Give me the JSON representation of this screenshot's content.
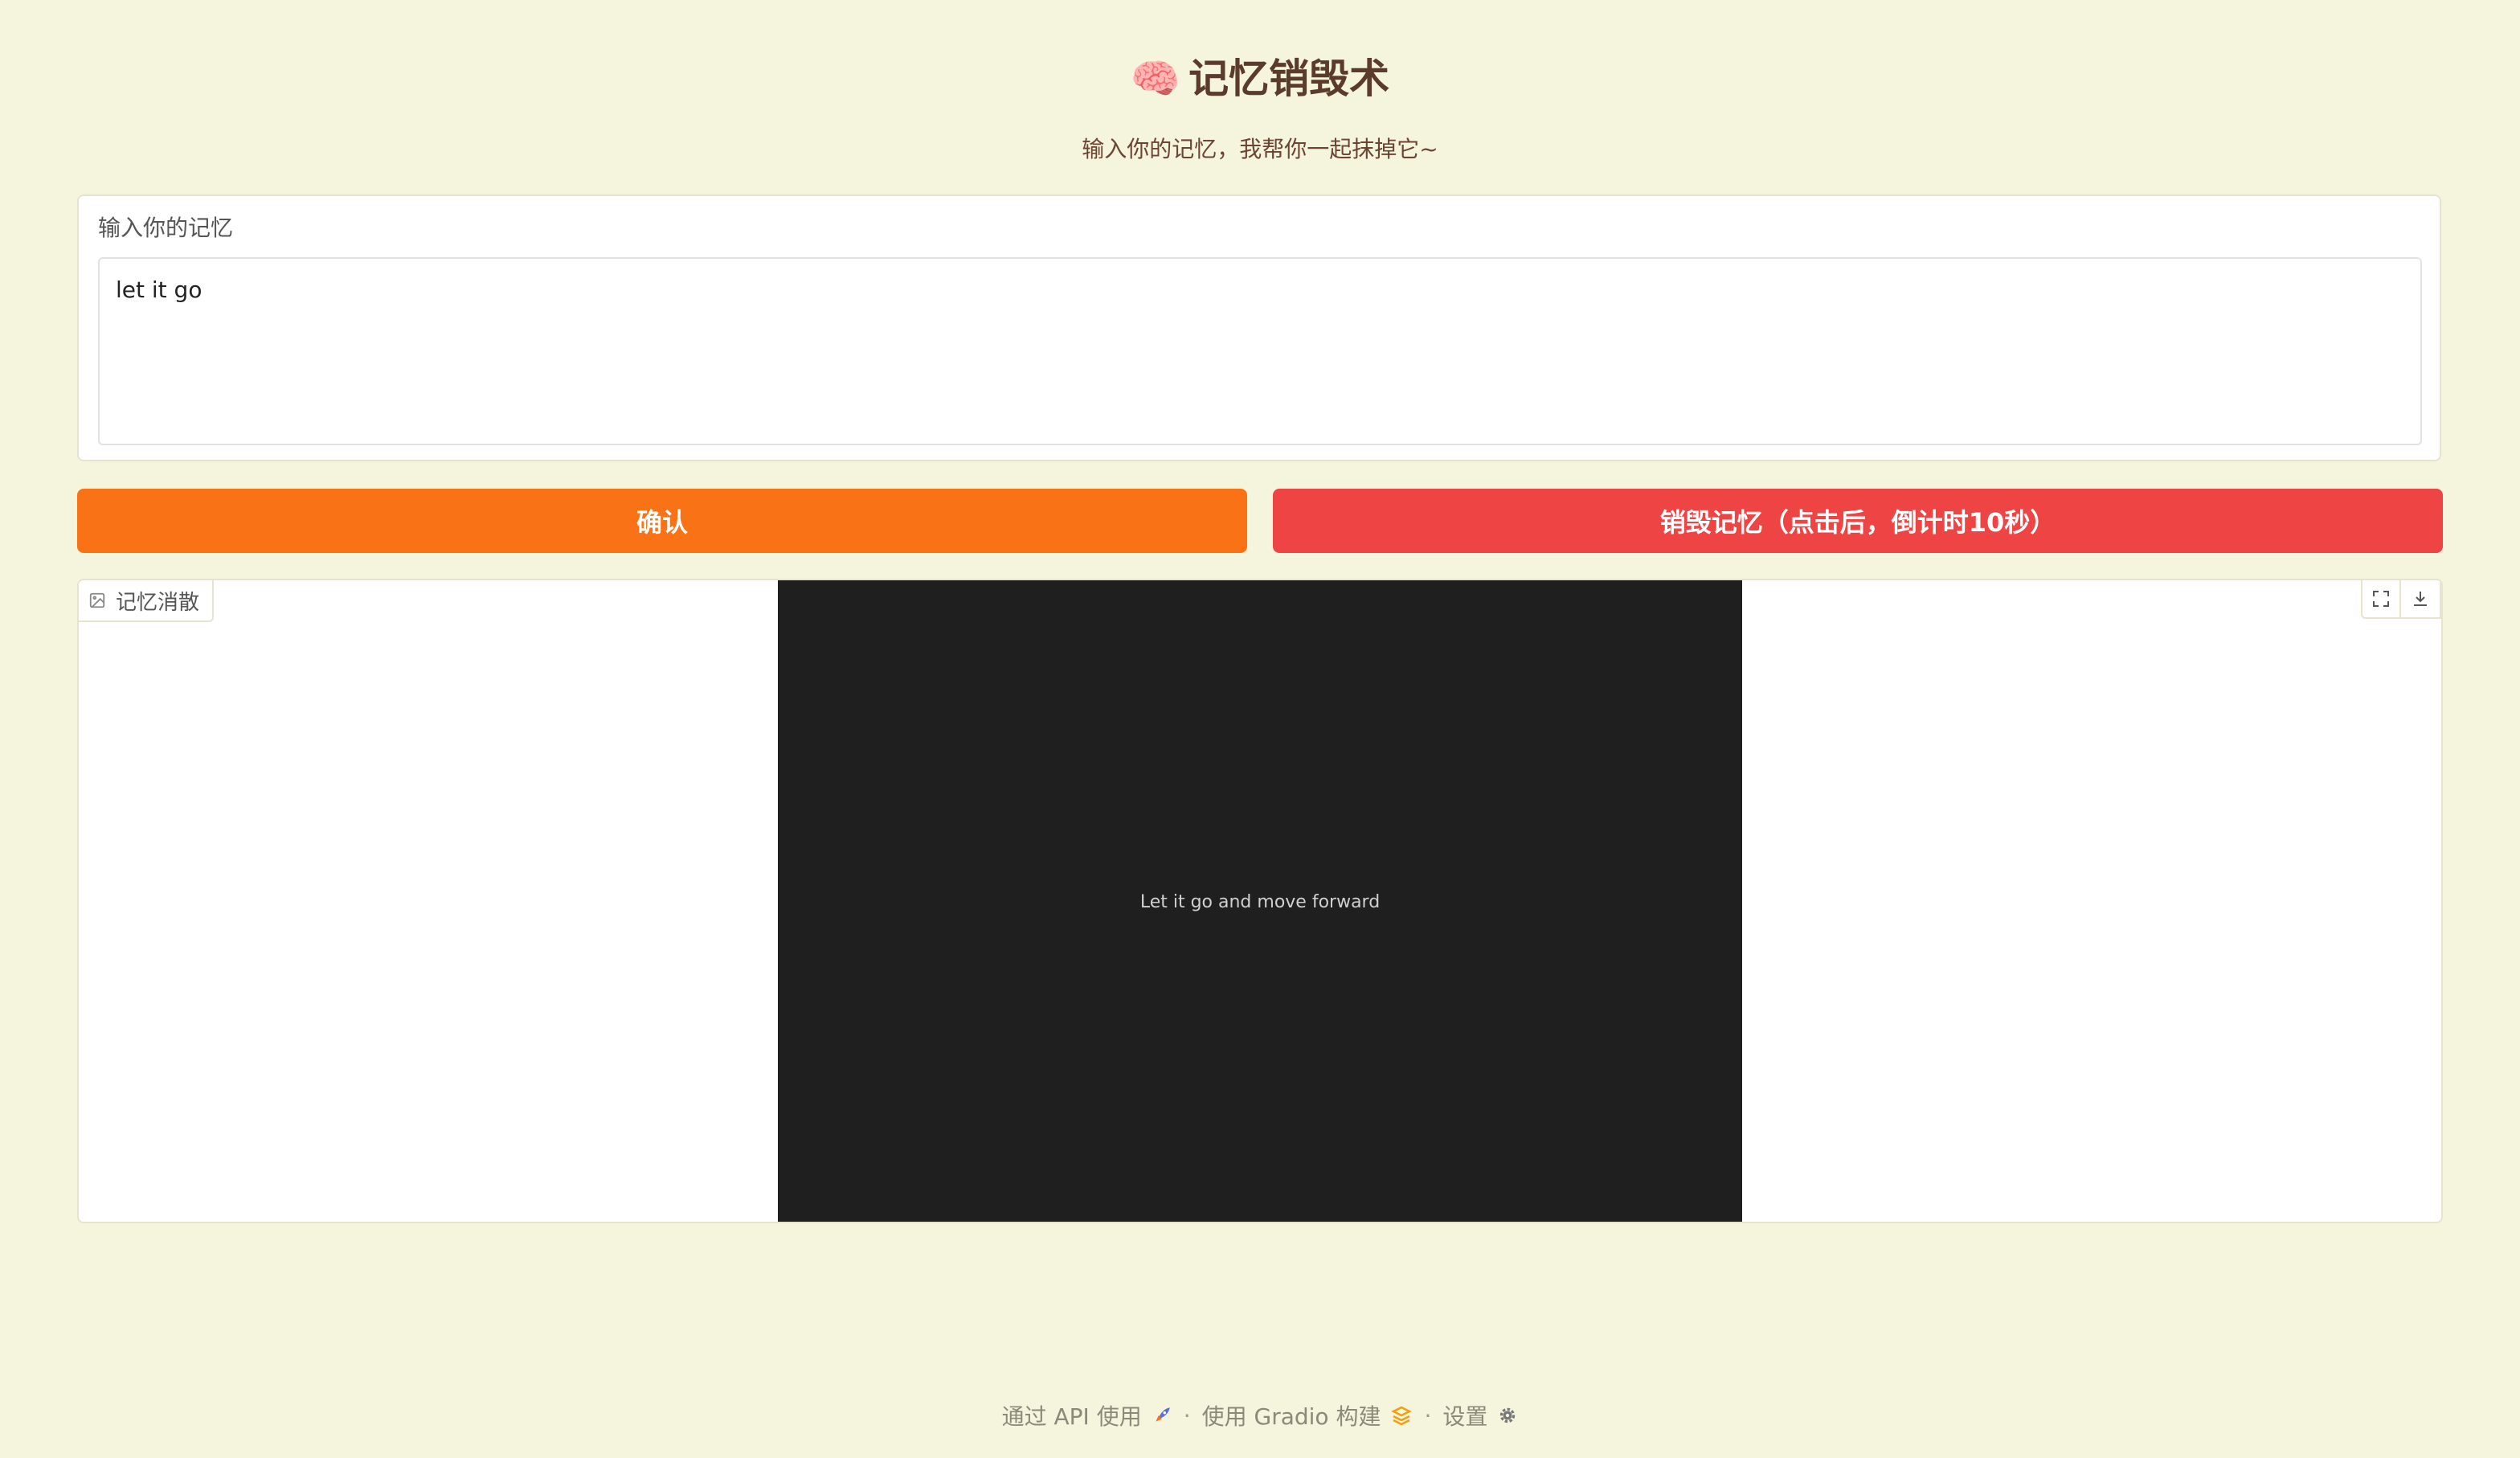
{
  "header": {
    "title": "记忆销毁术",
    "title_icon": "brain-emoji",
    "subtitle": "输入你的记忆，我帮你一起抹掉它~"
  },
  "input": {
    "label": "输入你的记忆",
    "value": "let it go"
  },
  "buttons": {
    "confirm_label": "确认",
    "destroy_label": "销毁记忆（点击后，倒计时10秒）"
  },
  "image_panel": {
    "label": "记忆消散",
    "image_text": "Let it go and move forward",
    "tools": [
      "fullscreen-icon",
      "download-icon"
    ]
  },
  "footer": {
    "api_label": "通过 API 使用",
    "separator": "·",
    "built_label": "使用 Gradio 构建",
    "settings_label": "设置"
  },
  "colors": {
    "background": "#f5f4dc",
    "confirm": "#f97316",
    "destroy": "#ef4444",
    "title": "#5b3b2c",
    "image_bg": "#1f1f1f"
  }
}
